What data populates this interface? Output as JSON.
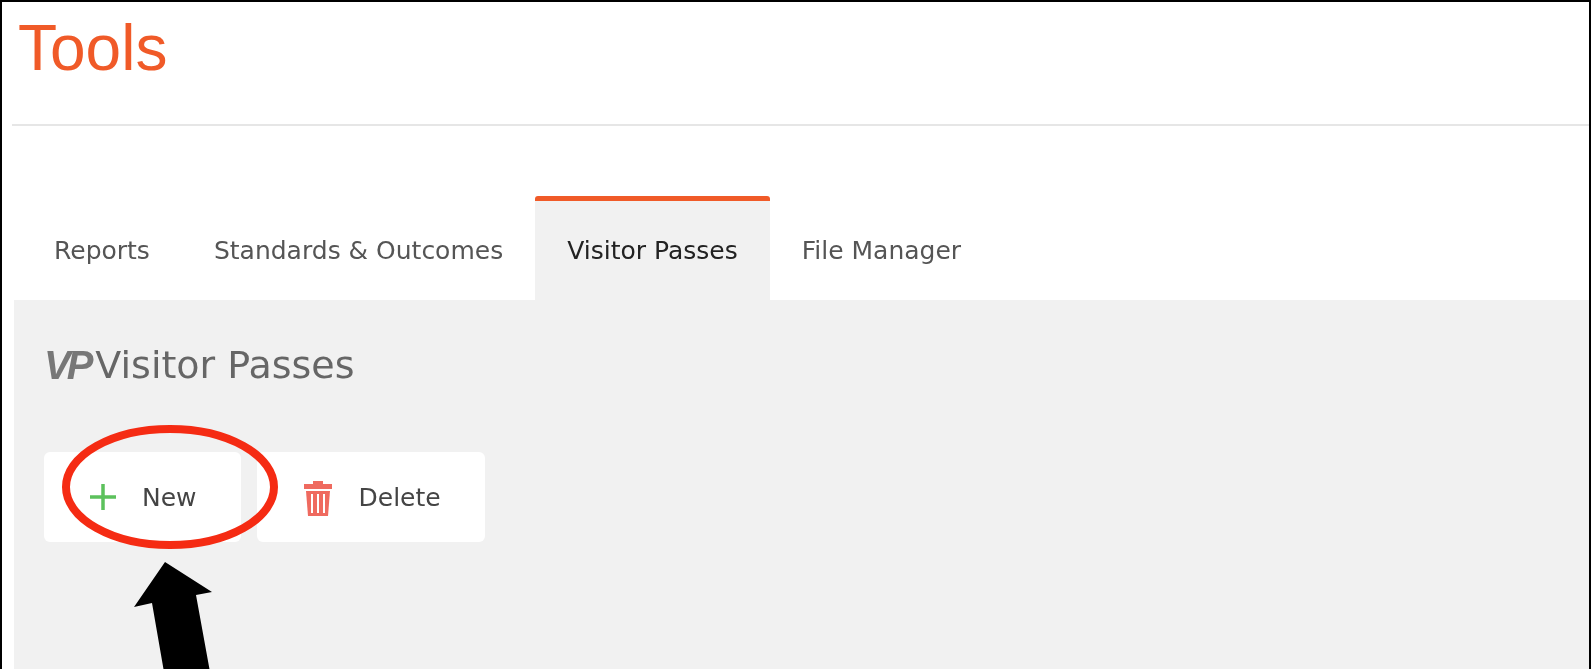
{
  "page": {
    "title": "Tools"
  },
  "tabs": [
    {
      "label": "Reports",
      "selected": false
    },
    {
      "label": "Standards & Outcomes",
      "selected": false
    },
    {
      "label": "Visitor Passes",
      "selected": true
    },
    {
      "label": "File Manager",
      "selected": false
    }
  ],
  "section": {
    "logo_text": "VP",
    "title": "Visitor Passes"
  },
  "toolbar": [
    {
      "kind": "new",
      "label": "New"
    },
    {
      "kind": "delete",
      "label": "Delete"
    }
  ]
}
